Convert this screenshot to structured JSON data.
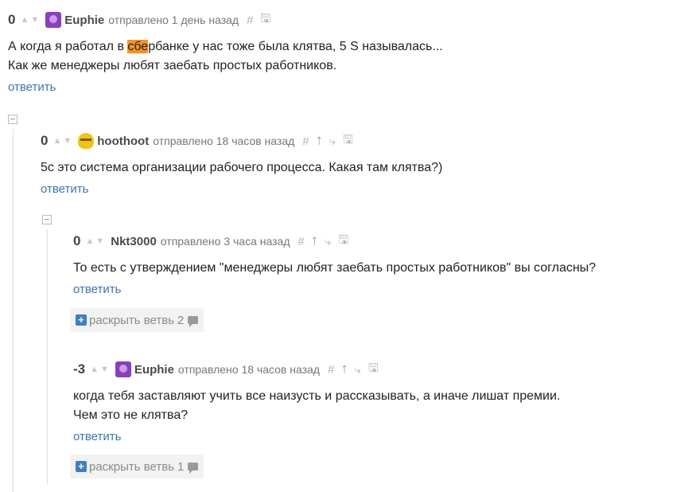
{
  "comments": [
    {
      "rating": "0",
      "author": "Euphie",
      "posted": "отправлено 1 день назад",
      "body_pre": "А когда я работал в ",
      "body_hl": "сбе",
      "body_post": "рбанке у нас тоже была клятва, 5 S называлась...",
      "body_line2": "Как же менеджеры любят заебать простых работников.",
      "reply": "ответить"
    },
    {
      "rating": "0",
      "author": "hoothoot",
      "posted": "отправлено 18 часов назад",
      "body_line1": "5с это система организации рабочего процесса. Какая там клятва?)",
      "reply": "ответить"
    },
    {
      "rating": "0",
      "author": "Nkt3000",
      "posted": "отправлено 3 часа назад",
      "body_line1": "То есть с утверждением \"менеджеры любят заебать простых работников\" вы согласны?",
      "reply": "ответить",
      "expand_label": "раскрыть ветвь",
      "expand_count": "2"
    },
    {
      "rating": "-3",
      "author": "Euphie",
      "posted": "отправлено 18 часов назад",
      "body_line1": "когда тебя заставляют учить все наизусть и рассказывать, а иначе лишат премии.",
      "body_line2": "Чем это не клятва?",
      "reply": "ответить",
      "expand_label": "раскрыть ветвь",
      "expand_count": "1"
    }
  ],
  "tool_icons": {
    "link": "#",
    "parent": "⭡",
    "thread": "⤷",
    "save": "🖫"
  }
}
